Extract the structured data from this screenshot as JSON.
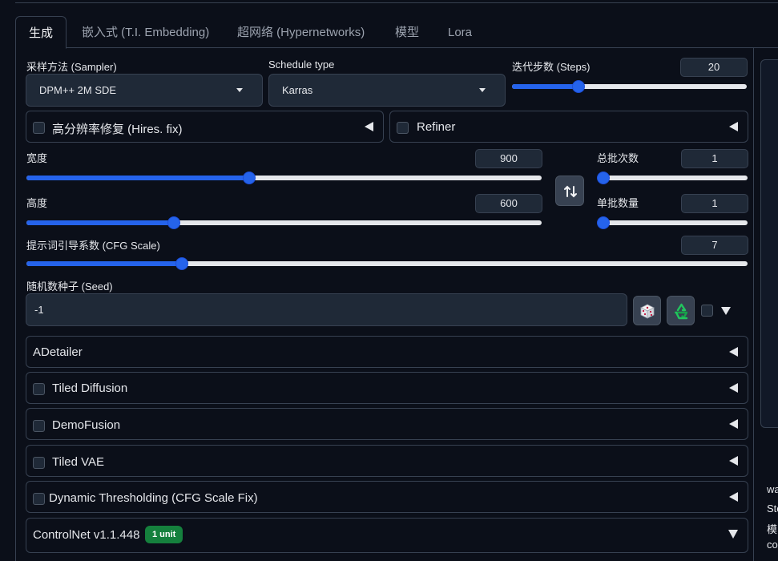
{
  "tabs": [
    {
      "label": "生成"
    },
    {
      "label": "嵌入式 (T.I. Embedding)"
    },
    {
      "label": "超网络 (Hypernetworks)"
    },
    {
      "label": "模型"
    },
    {
      "label": "Lora"
    }
  ],
  "sampler": {
    "label": "采样方法 (Sampler)",
    "value": "DPM++ 2M SDE"
  },
  "schedule": {
    "label": "Schedule type",
    "value": "Karras"
  },
  "steps": {
    "label": "迭代步数 (Steps)",
    "value": "20",
    "fraction": 0.27
  },
  "hires": {
    "label": "高分辨率修复 (Hires. fix)"
  },
  "refiner": {
    "label": "Refiner"
  },
  "width": {
    "label": "宽度",
    "value": "900",
    "fraction": 0.43
  },
  "height": {
    "label": "高度",
    "value": "600",
    "fraction": 0.28
  },
  "swap": {
    "icon": "swap-icon"
  },
  "batch_count": {
    "label": "总批次数",
    "value": "1",
    "fraction": 0.0
  },
  "batch_size": {
    "label": "单批数量",
    "value": "1",
    "fraction": 0.0
  },
  "cfg": {
    "label": "提示词引导系数 (CFG Scale)",
    "value": "7",
    "fraction": 0.21
  },
  "seed": {
    "label": "随机数种子 (Seed)",
    "value": "-1"
  },
  "extensions": [
    {
      "label": "ADetailer",
      "checkbox": false
    },
    {
      "label": "Tiled Diffusion",
      "checkbox": true
    },
    {
      "label": "DemoFusion",
      "checkbox": true
    },
    {
      "label": "Tiled VAE",
      "checkbox": true
    },
    {
      "label": "Dynamic Thresholding (CFG Scale Fix)",
      "checkbox": true
    }
  ],
  "controlnet": {
    "label": "ControlNet v1.1.448",
    "badge": "1 unit"
  },
  "right_text": [
    "wa",
    "Ste",
    "模",
    "co"
  ],
  "colors": {
    "accent": "#2563eb",
    "badge": "#15803d",
    "background": "#0b0f19",
    "field": "#1f2937"
  }
}
